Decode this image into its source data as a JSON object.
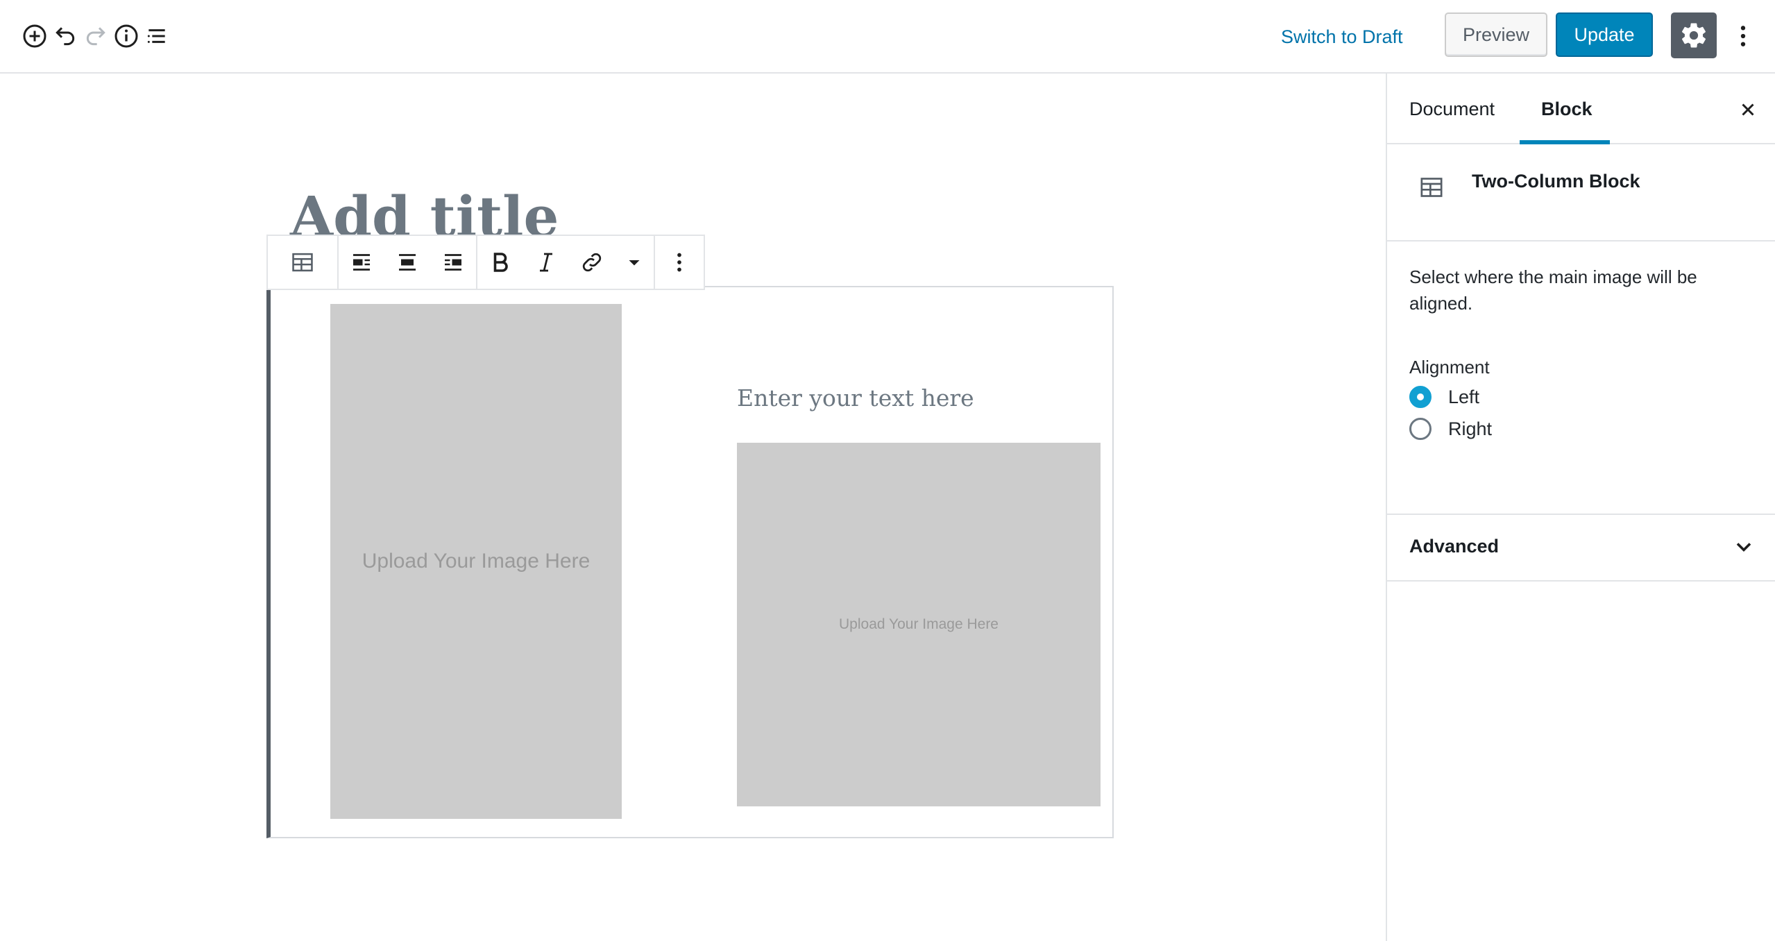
{
  "topbar": {
    "icons": [
      "add-block-icon",
      "undo-icon",
      "redo-icon",
      "info-icon",
      "block-navigation-icon"
    ],
    "switch_to_draft": "Switch to Draft",
    "preview": "Preview",
    "update": "Update",
    "settings_icon": "gear-icon",
    "more_icon": "vertical-ellipsis-icon"
  },
  "editor": {
    "title_placeholder": "Add title",
    "toolbar": {
      "icons": [
        "two-column-block-icon",
        "align-left-icon",
        "align-center-icon",
        "align-right-icon",
        "bold-icon",
        "italic-icon",
        "link-icon",
        "caret-down-icon",
        "vertical-ellipsis-icon"
      ]
    },
    "block": {
      "main_image_label": "Upload Your Image Here",
      "text_placeholder": "Enter your text here",
      "secondary_image_label": "Upload Your Image Here"
    }
  },
  "sidebar": {
    "tabs": [
      {
        "label": "Document",
        "active": false
      },
      {
        "label": "Block",
        "active": true
      }
    ],
    "block_card": {
      "title": "Two-Column Block",
      "icon": "table-icon"
    },
    "help_text": "Select where the main image will be aligned.",
    "alignment": {
      "label": "Alignment",
      "options": [
        {
          "label": "Left",
          "checked": true
        },
        {
          "label": "Right",
          "checked": false
        }
      ]
    },
    "advanced_label": "Advanced"
  },
  "colors": {
    "accent": "#0085ba",
    "link": "#0073aa",
    "radio_checked": "#11a0d2",
    "placeholder_bg": "#cccccc",
    "dark_gray": "#555d66"
  }
}
